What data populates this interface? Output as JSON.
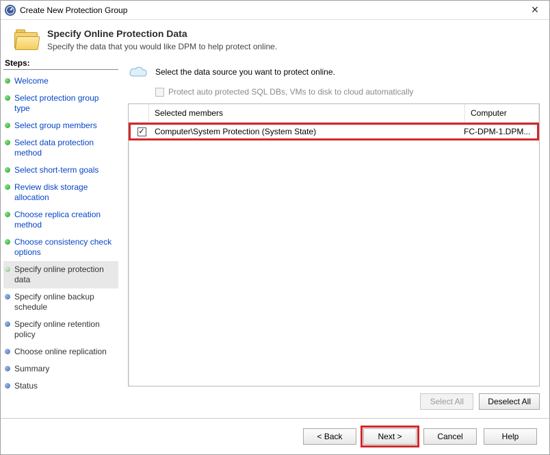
{
  "window": {
    "title": "Create New Protection Group"
  },
  "header": {
    "title": "Specify Online Protection Data",
    "subtitle": "Specify the data that you would like DPM to help protect online."
  },
  "steps": {
    "heading": "Steps:",
    "items": [
      {
        "label": "Welcome",
        "state": "completed"
      },
      {
        "label": "Select protection group type",
        "state": "completed"
      },
      {
        "label": "Select group members",
        "state": "completed"
      },
      {
        "label": "Select data protection method",
        "state": "completed"
      },
      {
        "label": "Select short-term goals",
        "state": "completed"
      },
      {
        "label": "Review disk storage allocation",
        "state": "completed"
      },
      {
        "label": "Choose replica creation method",
        "state": "completed"
      },
      {
        "label": "Choose consistency check options",
        "state": "completed"
      },
      {
        "label": "Specify online protection data",
        "state": "current"
      },
      {
        "label": "Specify online backup schedule",
        "state": "pending"
      },
      {
        "label": "Specify online retention policy",
        "state": "pending"
      },
      {
        "label": "Choose online replication",
        "state": "pending"
      },
      {
        "label": "Summary",
        "state": "pending"
      },
      {
        "label": "Status",
        "state": "pending"
      }
    ]
  },
  "main": {
    "instruction": "Select the data source you want to protect online.",
    "auto_protect_label": "Protect auto protected SQL DBs, VMs to disk to cloud automatically",
    "columns": {
      "member": "Selected members",
      "computer": "Computer"
    },
    "rows": [
      {
        "checked": true,
        "member": "Computer\\System Protection (System State)",
        "computer": "FC-DPM-1.DPM..."
      }
    ],
    "select_all": "Select All",
    "deselect_all": "Deselect All"
  },
  "footer": {
    "back": "< Back",
    "next": "Next >",
    "cancel": "Cancel",
    "help": "Help"
  }
}
